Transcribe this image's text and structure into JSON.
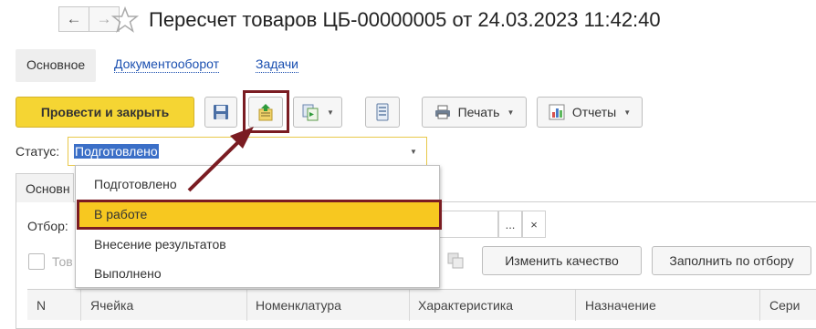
{
  "window": {
    "title": "Пересчет товаров ЦБ-00000005 от 24.03.2023 11:42:40"
  },
  "nav": {
    "back_icon": "arrow-left-icon",
    "forward_icon": "arrow-right-icon",
    "favorite_icon": "star-icon"
  },
  "form_tabs": [
    {
      "label": "Основное",
      "active": true
    },
    {
      "label": "Документооборот",
      "active": false
    },
    {
      "label": "Задачи",
      "active": false
    }
  ],
  "toolbar": {
    "post_close_label": "Провести и закрыть",
    "save_icon": "floppy-disk-icon",
    "status_icon": "document-green-arrow-icon",
    "create_based_icon": "create-based-on-icon",
    "list_icon": "list-icon",
    "print_label": "Печать",
    "reports_label": "Отчеты"
  },
  "status": {
    "label": "Статус:",
    "value": "Подготовлено",
    "options": [
      "Подготовлено",
      "В работе",
      "Внесение результатов",
      "Выполнено"
    ],
    "highlighted_option": "В работе"
  },
  "inner_tab": {
    "label": "Основн"
  },
  "filter": {
    "label": "Отбор:",
    "select_label": "...",
    "clear_label": "×"
  },
  "row_controls": {
    "checkbox_label": "Тов",
    "change_quality_label": "Изменить качество",
    "fill_by_filter_label": "Заполнить по отбору"
  },
  "table": {
    "columns": [
      "N",
      "Ячейка",
      "Номенклатура",
      "Характеристика",
      "Назначение",
      "Сери"
    ]
  },
  "colors": {
    "accent_yellow": "#f5d533",
    "annotation_red": "#7a1c22",
    "selection_blue": "#3b6fc7",
    "link_blue": "#1a4fb0"
  }
}
